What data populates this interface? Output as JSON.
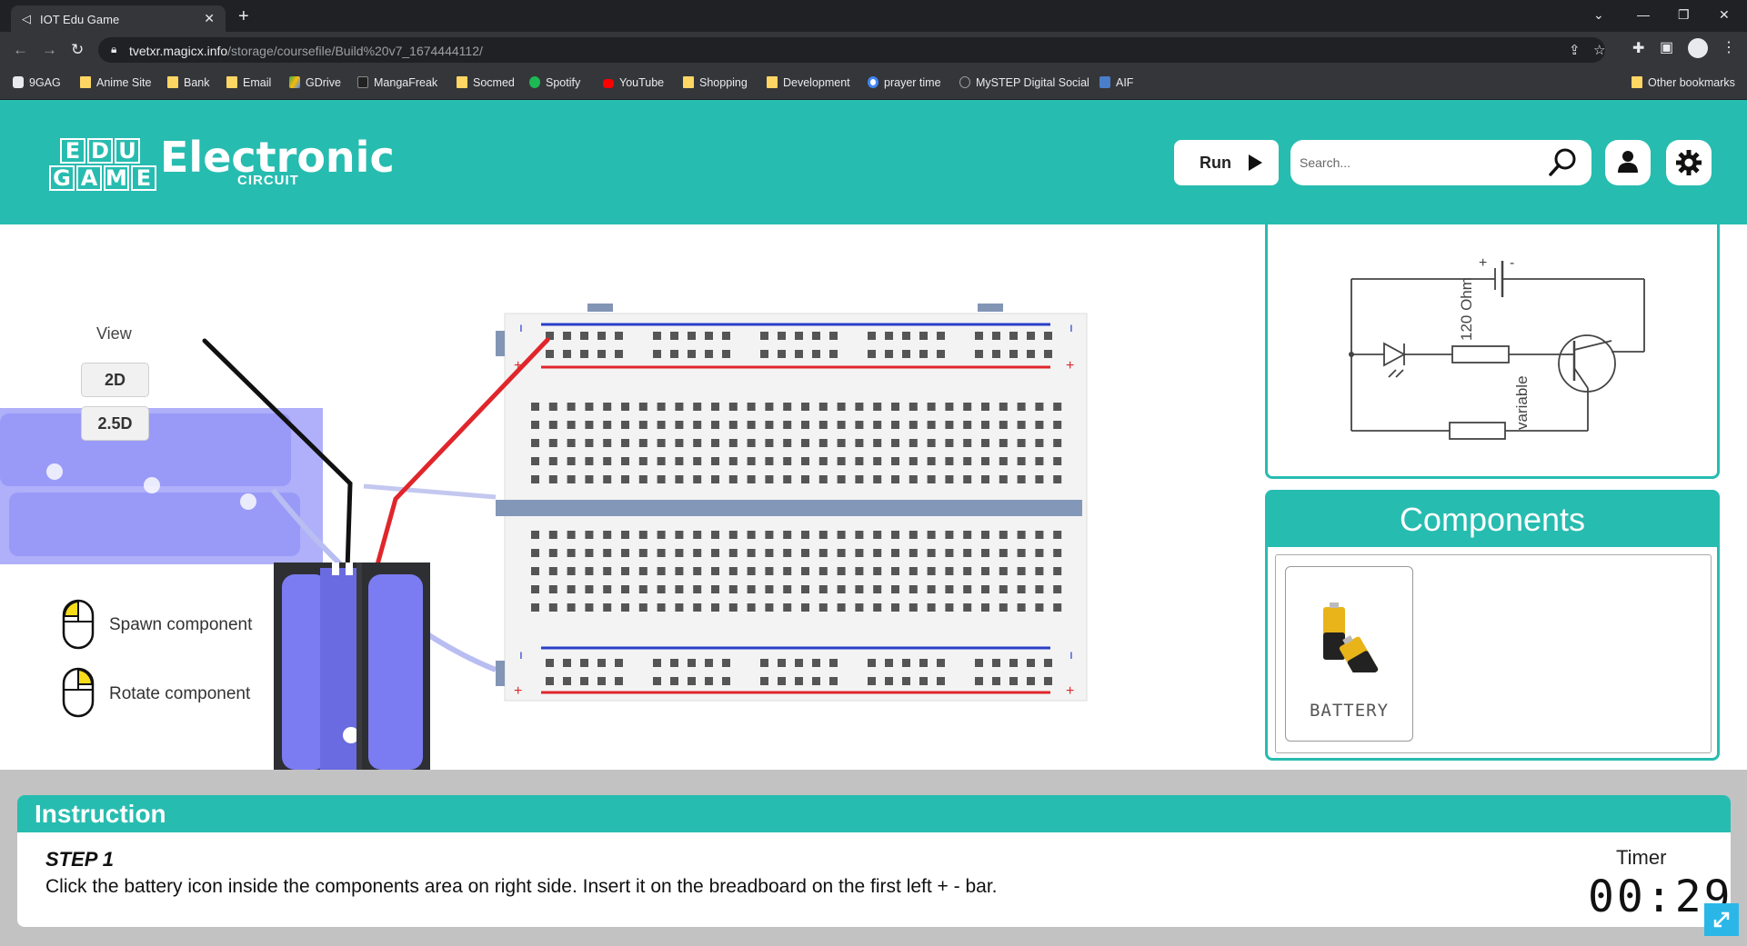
{
  "browser": {
    "tab_title": "IOT Edu Game",
    "url_host": "tvetxr.magicx.info",
    "url_path": "/storage/coursefile/Build%20v7_1674444112/",
    "bookmarks": [
      "9GAG",
      "Anime Site",
      "Bank",
      "Email",
      "GDrive",
      "MangaFreak",
      "Socmed",
      "Spotify",
      "YouTube",
      "Shopping",
      "Development",
      "prayer time",
      "MySTEP Digital Social",
      "AIF"
    ],
    "other_bookmarks": "Other bookmarks"
  },
  "header": {
    "logo_letters": [
      "E",
      "D",
      "U",
      "G",
      "A",
      "M",
      "E"
    ],
    "title": "Electronic",
    "subtitle": "CIRCUIT",
    "run_label": "Run",
    "search_placeholder": "Search..."
  },
  "workspace": {
    "view_label": "View",
    "view_2d": "2D",
    "view_25d": "2.5D",
    "hint_spawn": "Spawn component",
    "hint_rotate": "Rotate component"
  },
  "schematic": {
    "resistor_label": "120 Ohm",
    "variable_label": "variable",
    "plus": "+",
    "minus": "-"
  },
  "components": {
    "header": "Components",
    "items": [
      {
        "name": "BATTERY"
      }
    ]
  },
  "instruction": {
    "header": "Instruction",
    "step": "STEP 1",
    "text": "Click the battery icon inside the components area on right side. Insert it on the breadboard on the first left + - bar.",
    "timer_label": "Timer",
    "timer_value": "00:29"
  },
  "colors": {
    "teal": "#27bcb0",
    "rail_blue": "#2a3fc7",
    "rail_red": "#e0262b",
    "battery_blue": "#7b7cf2"
  }
}
